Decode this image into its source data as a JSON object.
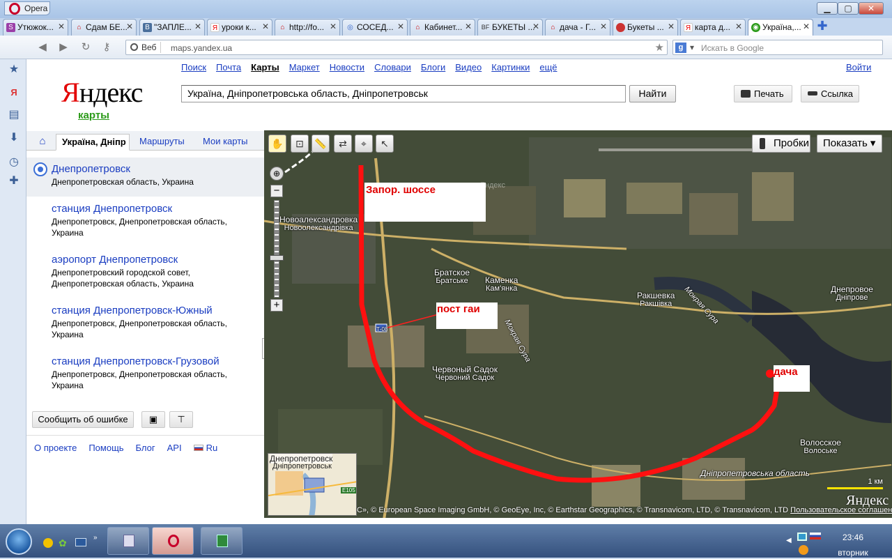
{
  "browser": {
    "app_name": "Opera",
    "tabs": [
      {
        "label": "Утюжок...",
        "icon": "ss-icon"
      },
      {
        "label": "Сдам БЕ...",
        "icon": "home-icon"
      },
      {
        "label": "\"ЗАПЛЕ...",
        "icon": "vk-icon"
      },
      {
        "label": "уроки к...",
        "icon": "yandex-icon"
      },
      {
        "label": "http://fo...",
        "icon": "home-icon"
      },
      {
        "label": "СОСЕД...",
        "icon": "globe-icon"
      },
      {
        "label": "Кабинет...",
        "icon": "home-icon"
      },
      {
        "label": "БУКЕТЫ ...",
        "icon": "bf-icon"
      },
      {
        "label": "дача - Г...",
        "icon": "home-icon"
      },
      {
        "label": "Букеты ...",
        "icon": "ladybug-icon"
      },
      {
        "label": "карта д...",
        "icon": "yandex-icon"
      },
      {
        "label": "Україна,...",
        "icon": "maps-icon"
      }
    ],
    "address_mode": "Веб",
    "url": "maps.yandex.ua",
    "search_placeholder": "Искать в Google",
    "win_min": "▁",
    "win_max": "▢",
    "win_close": "✕"
  },
  "header": {
    "logo_first": "Я",
    "logo_rest": "ндекс",
    "logo_sub": "карты",
    "nav": [
      "Поиск",
      "Почта",
      "Карты",
      "Маркет",
      "Новости",
      "Словари",
      "Блоги",
      "Видео",
      "Картинки",
      "ещё"
    ],
    "login": "Войти",
    "query": "Україна, Дніпропетровська область, Дніпропетровськ",
    "find_label": "Найти",
    "print_label": "Печать",
    "link_label": "Ссылка"
  },
  "sidebar": {
    "tabs": {
      "home": "⌂",
      "active": "Україна, Дніпр",
      "routes": "Маршруты",
      "mymaps": "Мои карты"
    },
    "results": [
      {
        "title": "Днепропетровск",
        "desc": "Днепропетровская область, Украина"
      },
      {
        "title": "станция Днепропетровск",
        "desc": "Днепропетровск, Днепропетровская область, Украина"
      },
      {
        "title": "аэропорт Днепропетровск",
        "desc": "Днепропетровский городской совет, Днепропетровская область, Украина"
      },
      {
        "title": "станция Днепропетровск-Южный",
        "desc": "Днепропетровск, Днепропетровская область, Украина"
      },
      {
        "title": "станция Днепропетровск-Грузовой",
        "desc": "Днепропетровск, Днепропетровская область, Украина"
      }
    ],
    "report_error": "Сообщить об ошибке",
    "footer": [
      "О проекте",
      "Помощь",
      "Блог",
      "API",
      "Ru"
    ]
  },
  "map": {
    "traffic_label": "Пробки",
    "show_label": "Показать ▾",
    "places": {
      "novoaleksandrovka_ru": "Новоалександровка",
      "novoaleksandrovka_ua": "Новоолександрівка",
      "bratskoe_ru": "Братское",
      "bratskoe_ua": "Братське",
      "kamenka_ru": "Каменка",
      "kamenka_ua": "Кам'янка",
      "rakshevka_ru": "Ракшевка",
      "rakshevka_ua": "Ракшівка",
      "dneprovoe_ru": "Днепровое",
      "dneprovoe_ua": "Дніпрове",
      "chervonyi_ru": "Червоный Садок",
      "chervonyi_ua": "Червоний Садок",
      "volosskoe_ru": "Волосское",
      "volosskoe_ua": "Волоське",
      "oblast_ua": "Дніпропетровська область",
      "mokraya_sura_1": "Мокрая Сура",
      "mokraya_sura_2": "Мокрая Сура",
      "road_badge": "Т-08",
      "yandex_watermark": "Яндекс"
    },
    "annotations": {
      "road": "Запор. шоссе",
      "police": "пост гаи",
      "dacha": "дача"
    },
    "minimap": {
      "city_ru": "Днепропетровск",
      "city_ua": "Дніпропетровськ",
      "road": "E105"
    },
    "scale_label": "1 км",
    "copyright": "С», © European Space Imaging GmbH, © GeoEye, Inc, © Earthstar Geographics, © Transnavicom, LTD, © Transnavicom, LTD",
    "terms": "Пользовательское соглашение",
    "logo": "Яндекс"
  },
  "taskbar": {
    "time": "23:46",
    "day": "вторник"
  }
}
